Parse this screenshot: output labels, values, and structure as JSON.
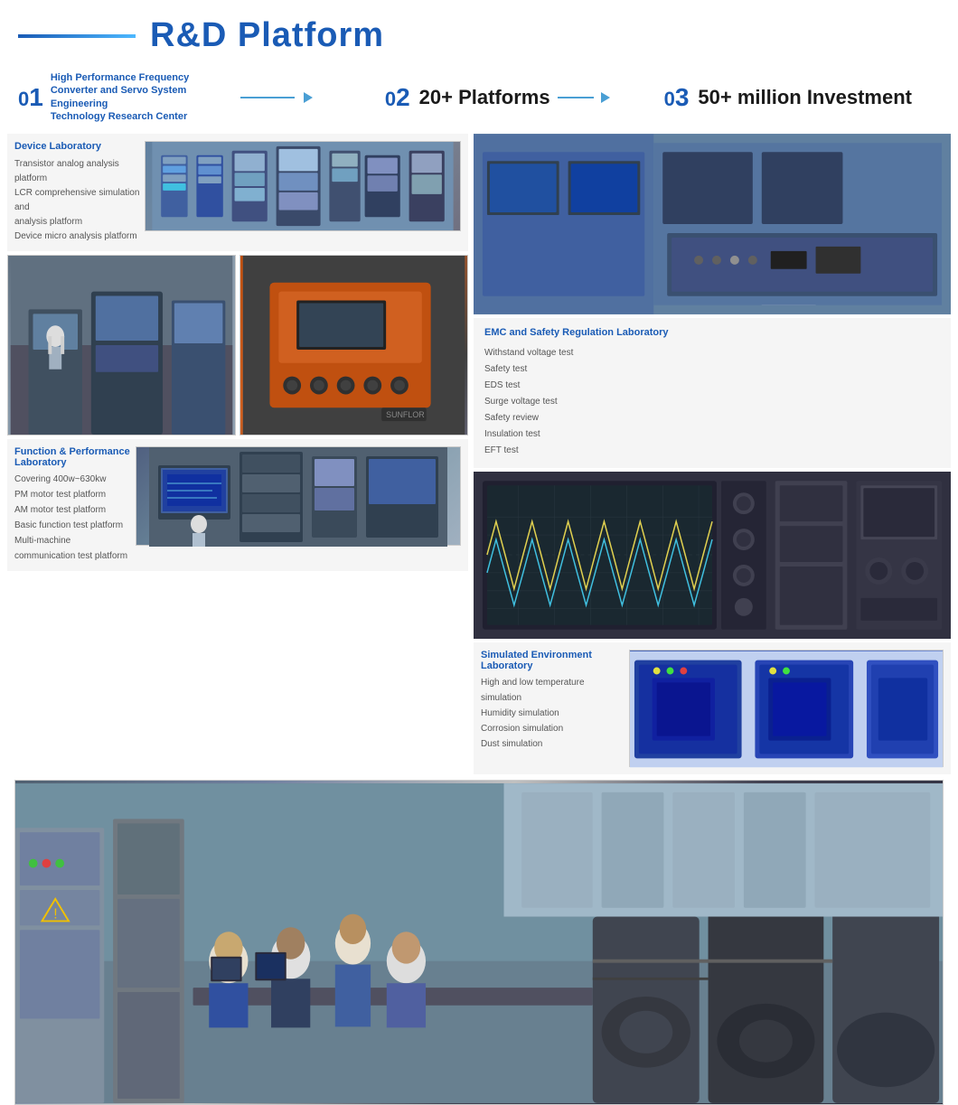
{
  "header": {
    "title_prefix": "R&D",
    "title_suffix": " Platform",
    "line_color": "#1a5bb5"
  },
  "badges": [
    {
      "number": "01",
      "text_line1": "High Performance Frequency Converter and Servo System Engineering",
      "text_line2": "Technology Research Center",
      "arrow": true
    },
    {
      "number": "02",
      "label": "20+ Platforms",
      "arrow": true
    },
    {
      "number": "03",
      "label": "50+ million Investment"
    }
  ],
  "device_lab": {
    "title": "Device Laboratory",
    "items": [
      "Transistor analog analysis platform",
      "LCR comprehensive simulation and",
      "analysis platform",
      "Device micro analysis platform"
    ]
  },
  "emc_lab": {
    "title": "EMC and Safety Regulation Laboratory",
    "items": [
      "Withstand voltage test",
      "Safety test",
      "EDS test",
      "Surge voltage test",
      "Safety review",
      "Insulation test",
      "EFT test"
    ]
  },
  "func_lab": {
    "title": "Function & Performance Laboratory",
    "items": [
      "Covering 400w~630kw",
      "PM motor test platform",
      "AM motor test platform",
      "Basic function test platform",
      "Multi-machine",
      "communication test platform"
    ]
  },
  "sim_lab": {
    "title": "Simulated Environment Laboratory",
    "items": [
      "High and low temperature simulation",
      "Humidity simulation",
      "Corrosion simulation",
      "Dust simulation"
    ]
  },
  "photos": {
    "device_lab_alt": "Device laboratory equipment",
    "machine1_alt": "Manufacturing floor with machines",
    "machine2_alt": "Orange industrial machine",
    "right_top_alt": "Lab with computer monitors",
    "right_mid_alt": "Electronic testing equipment with waveform",
    "func_lab_alt": "Function lab with test equipment",
    "sim_env_alt": "Blue environmental test chambers",
    "bottom_alt": "Engineering team at workstations with motors"
  }
}
